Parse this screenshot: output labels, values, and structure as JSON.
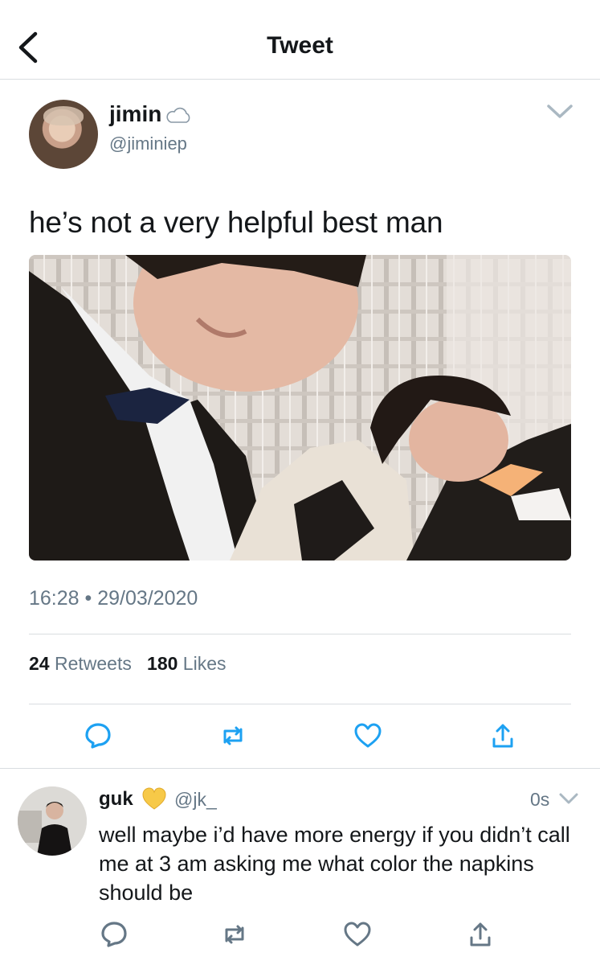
{
  "header": {
    "title": "Tweet",
    "back_icon": "chevron-left-icon"
  },
  "tweet": {
    "author_name": "jimin",
    "author_handle": "@jiminiep",
    "name_badge_icon": "cloud-icon",
    "text": "he’s not a very helpful best man",
    "timestamp": "16:28 • 29/03/2020",
    "retweets_count": "24",
    "retweets_label": "Retweets",
    "likes_count": "180",
    "likes_label": "Likes",
    "actions": [
      "reply-icon",
      "retweet-icon",
      "like-icon",
      "share-icon"
    ]
  },
  "reply": {
    "author_name": "guk",
    "name_badge_icon": "yellow-heart-icon",
    "author_handle": "@jk_",
    "time": "0s",
    "text": "well maybe i’d have more energy if you didn’t call me at 3 am asking me what color the napkins should be",
    "actions": [
      "reply-icon",
      "retweet-icon",
      "like-icon",
      "share-icon"
    ]
  },
  "colors": {
    "secondary_text": "#657786",
    "divider": "#d9dde0",
    "icon": "#1da1f2",
    "heart_badge": "#f7c948"
  }
}
